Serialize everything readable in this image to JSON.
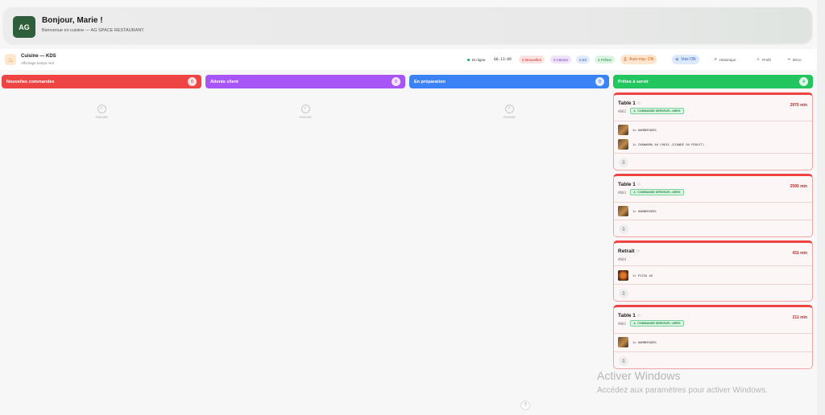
{
  "welcome": {
    "avatar": "AG",
    "title": "Bonjour, Marie !",
    "subtitle": "Bienvenue en cuisine — AG SPACE RESTAURANT."
  },
  "header": {
    "title": "Cuisine — KDS",
    "subtitle": "Affichage temps réel",
    "online": "En ligne",
    "time": "06:13:09",
    "new": "0 Nouvelles",
    "waiting": "0 Attente",
    "in_progress": "0 En",
    "ready": "4 Prêtes",
    "auto_print": "Auto-imp. ON",
    "voice": "Voix ON",
    "history": "Historique",
    "profile": "Profil",
    "logout": "Déco"
  },
  "columns": [
    {
      "title": "Nouvelles commandes",
      "count": "0",
      "empty": "Aucune"
    },
    {
      "title": "Attente client",
      "count": "0",
      "empty": "Aucune"
    },
    {
      "title": "En préparation",
      "count": "0",
      "empty": "Aucune"
    },
    {
      "title": "Prêtes à servir",
      "count": "4"
    }
  ],
  "cards": [
    {
      "table": "Table 1",
      "id": "#002",
      "badge": "COMMANDE SERVEUR • AREG",
      "time": "2970 min",
      "items": [
        "1× HAMBERGERS",
        "1× CHAWARMA AU CHOIX (VIANDE OU POULET)"
      ]
    },
    {
      "table": "Table 1",
      "id": "#003",
      "badge": "COMMANDE SERVEUR • AREG",
      "time": "2590 min",
      "items": [
        "1× HAMBERGERS"
      ]
    },
    {
      "table": "Retrait",
      "id": "#004",
      "badge": "",
      "time": "431 min",
      "items": [
        "1× PIZZA AG"
      ]
    },
    {
      "table": "Table 1",
      "id": "#001",
      "badge": "COMMANDE SERVEUR • AREG",
      "time": "211 min",
      "items": [
        "1× HAMBERGERS"
      ]
    }
  ],
  "watermark": {
    "line1": "Activer Windows",
    "line2": "Accédez aux paramètres pour activer Windows."
  },
  "colors": {
    "new": "#ef4444",
    "waiting": "#a855f7",
    "prep": "#3b82f6",
    "ready": "#22c55e"
  },
  "icons": {
    "logo": "chef-hat-icon",
    "print": "printer-icon",
    "help": "help-icon"
  }
}
